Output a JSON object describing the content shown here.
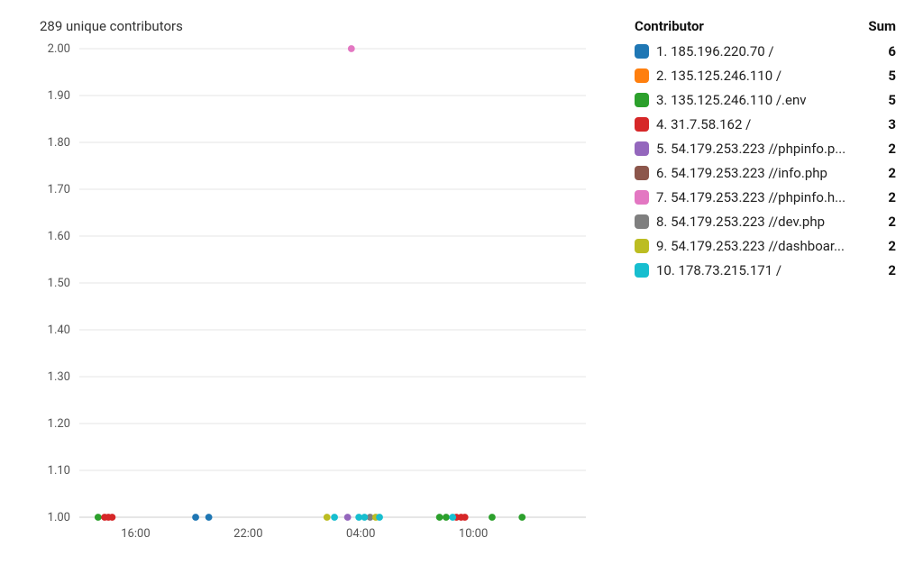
{
  "chart_data": {
    "type": "scatter",
    "title": "289 unique contributors",
    "ylabel": "",
    "xlabel": "",
    "ylim": [
      1.0,
      2.0
    ],
    "y_ticks": [
      1.0,
      1.1,
      1.2,
      1.3,
      1.4,
      1.5,
      1.6,
      1.7,
      1.8,
      1.9,
      2.0
    ],
    "x_categories": [
      "16:00",
      "22:00",
      "04:00",
      "10:00"
    ],
    "x_range_hours": [
      13,
      15.99
    ],
    "series": [
      {
        "name": "1. 185.196.220.70 /",
        "color": "#1f77b4",
        "points": [
          {
            "hour": 19.2,
            "v": 1.0
          },
          {
            "hour": 19.9,
            "v": 1.0
          }
        ]
      },
      {
        "name": "2. 135.125.246.110 /",
        "color": "#ff7f0e",
        "points": []
      },
      {
        "name": "3. 135.125.246.110 /.env",
        "color": "#2ca02c",
        "points": [
          {
            "hour": 8.2,
            "v": 1.0
          },
          {
            "hour": 8.55,
            "v": 1.0
          },
          {
            "hour": 11.0,
            "v": 1.0
          },
          {
            "hour": 12.6,
            "v": 1.0
          },
          {
            "hour": 14.0,
            "v": 1.0
          }
        ]
      },
      {
        "name": "4. 31.7.58.162 /",
        "color": "#d62728",
        "points": [
          {
            "hour": 9.1,
            "v": 1.0
          },
          {
            "hour": 9.35,
            "v": 1.0
          },
          {
            "hour": 9.55,
            "v": 1.0
          },
          {
            "hour": 14.35,
            "v": 1.0
          },
          {
            "hour": 14.55,
            "v": 1.0
          },
          {
            "hour": 14.75,
            "v": 1.0
          }
        ]
      },
      {
        "name": "5. 54.179.253.223 //phpinfo.p...",
        "color": "#9467bd",
        "points": [
          {
            "hour": 3.3,
            "v": 1.0
          }
        ]
      },
      {
        "name": "6. 54.179.253.223 //info.php",
        "color": "#8c564b",
        "points": []
      },
      {
        "name": "7. 54.179.253.223 //phpinfo.h...",
        "color": "#e377c2",
        "points": [
          {
            "hour": 3.5,
            "v": 2.0
          }
        ]
      },
      {
        "name": "8. 54.179.253.223 //dev.php",
        "color": "#7f7f7f",
        "points": [
          {
            "hour": 4.5,
            "v": 1.0
          }
        ]
      },
      {
        "name": "9. 54.179.253.223 //dashboar...",
        "color": "#bcbd22",
        "points": [
          {
            "hour": 2.2,
            "v": 1.0
          },
          {
            "hour": 4.8,
            "v": 1.0
          }
        ]
      },
      {
        "name": "10. 178.73.215.171 /",
        "color": "#17becf",
        "points": [
          {
            "hour": 2.6,
            "v": 1.0
          },
          {
            "hour": 3.9,
            "v": 1.0
          },
          {
            "hour": 4.2,
            "v": 1.0
          },
          {
            "hour": 5.0,
            "v": 1.0
          },
          {
            "hour": 8.9,
            "v": 1.0
          }
        ]
      }
    ]
  },
  "legend": {
    "header_label": "Contributor",
    "header_sum": "Sum",
    "rows": [
      {
        "label": "1. 185.196.220.70 /",
        "sum": "6",
        "color": "#1f77b4"
      },
      {
        "label": "2. 135.125.246.110 /",
        "sum": "5",
        "color": "#ff7f0e"
      },
      {
        "label": "3. 135.125.246.110 /.env",
        "sum": "5",
        "color": "#2ca02c"
      },
      {
        "label": "4. 31.7.58.162 /",
        "sum": "3",
        "color": "#d62728"
      },
      {
        "label": "5. 54.179.253.223 //phpinfo.p...",
        "sum": "2",
        "color": "#9467bd"
      },
      {
        "label": "6. 54.179.253.223 //info.php",
        "sum": "2",
        "color": "#8c564b"
      },
      {
        "label": "7. 54.179.253.223 //phpinfo.h...",
        "sum": "2",
        "color": "#e377c2"
      },
      {
        "label": "8. 54.179.253.223 //dev.php",
        "sum": "2",
        "color": "#7f7f7f"
      },
      {
        "label": "9. 54.179.253.223 //dashboar...",
        "sum": "2",
        "color": "#bcbd22"
      },
      {
        "label": "10. 178.73.215.171 /",
        "sum": "2",
        "color": "#17becf"
      }
    ]
  }
}
